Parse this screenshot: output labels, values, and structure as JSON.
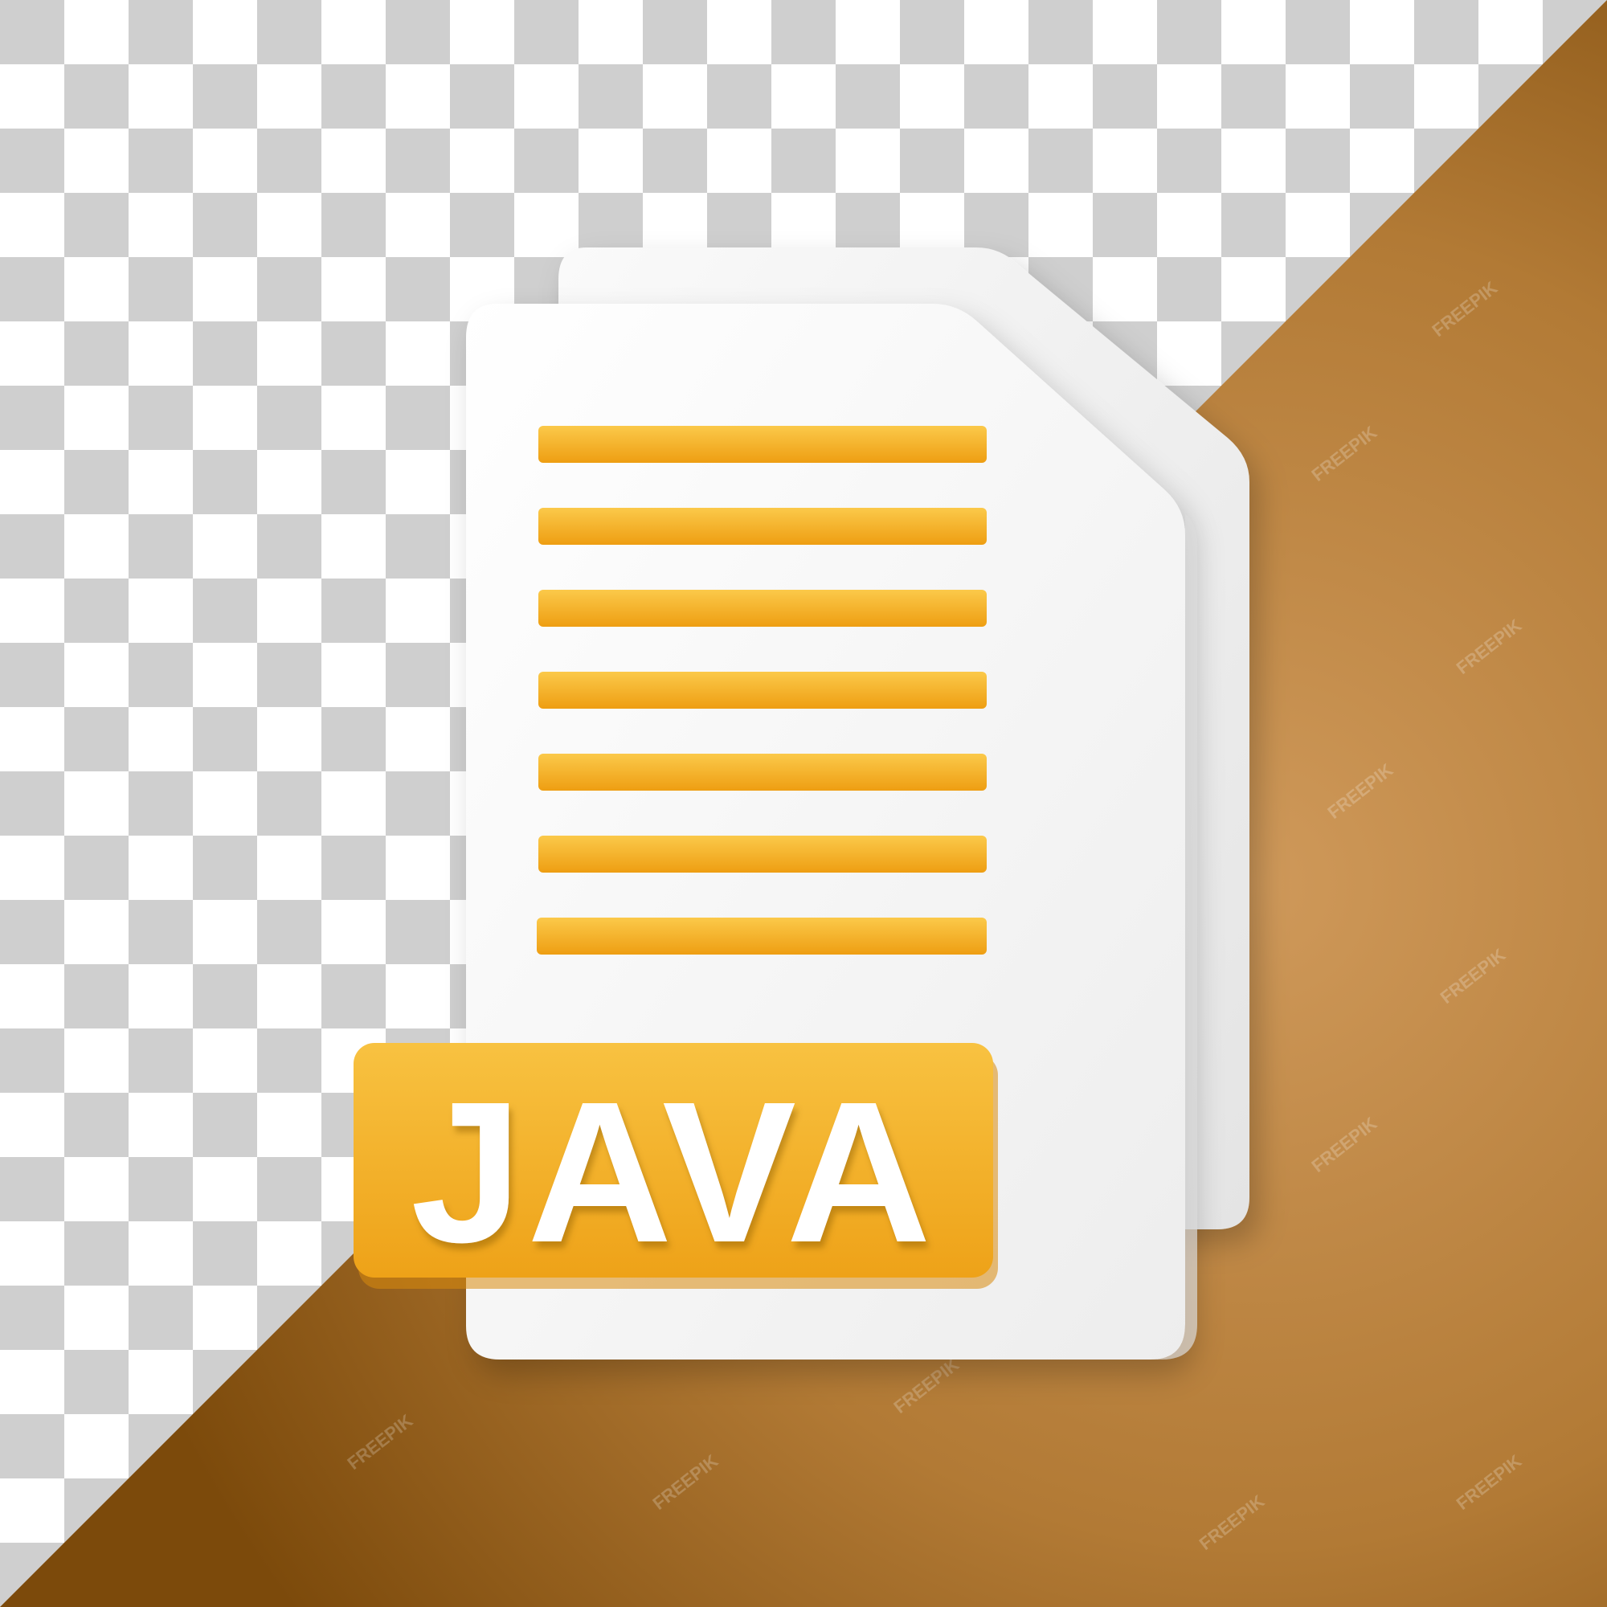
{
  "badge": {
    "label": "JAVA"
  },
  "watermark": {
    "text": "FREEPIK"
  },
  "colors": {
    "checker_light": "#ffffff",
    "checker_dark": "#cfcfcf",
    "brown_light": "#c98f4f",
    "brown_dark": "#7c4a0b",
    "paper": "#f7f7f7",
    "paper_shadow": "#e6e6e6",
    "accent": "#f7b733",
    "accent_dark": "#e79a12",
    "badge_text": "#ffffff"
  },
  "icons": {
    "document": "document-stack-icon",
    "text_lines": "text-lines-icon"
  }
}
